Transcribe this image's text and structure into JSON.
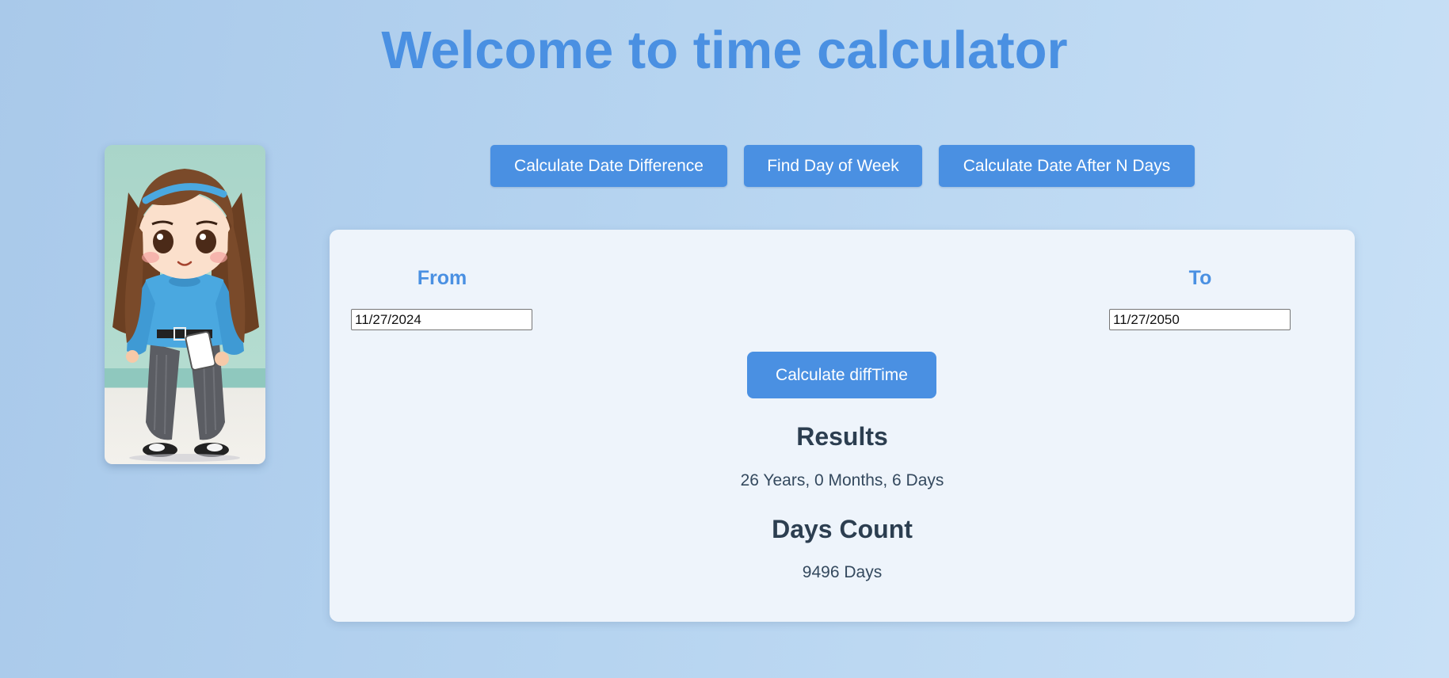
{
  "page": {
    "title": "Welcome to time calculator"
  },
  "tabs": [
    {
      "label": "Calculate Date Difference"
    },
    {
      "label": "Find Day of Week"
    },
    {
      "label": "Calculate Date After N Days"
    }
  ],
  "calculator": {
    "from_label": "From",
    "from_value": "11/27/2024",
    "to_label": "To",
    "to_value": "11/27/2050",
    "calculate_label": "Calculate diffTime"
  },
  "results": {
    "heading": "Results",
    "value": "26 Years, 0 Months, 6 Days"
  },
  "days_count": {
    "heading": "Days Count",
    "value": "9496 Days"
  },
  "colors": {
    "accent": "#4a90e2",
    "heading_text": "#2c3e50",
    "card_background": "#eef4fb"
  },
  "icons": {
    "portrait": "girl-character-illustration"
  }
}
